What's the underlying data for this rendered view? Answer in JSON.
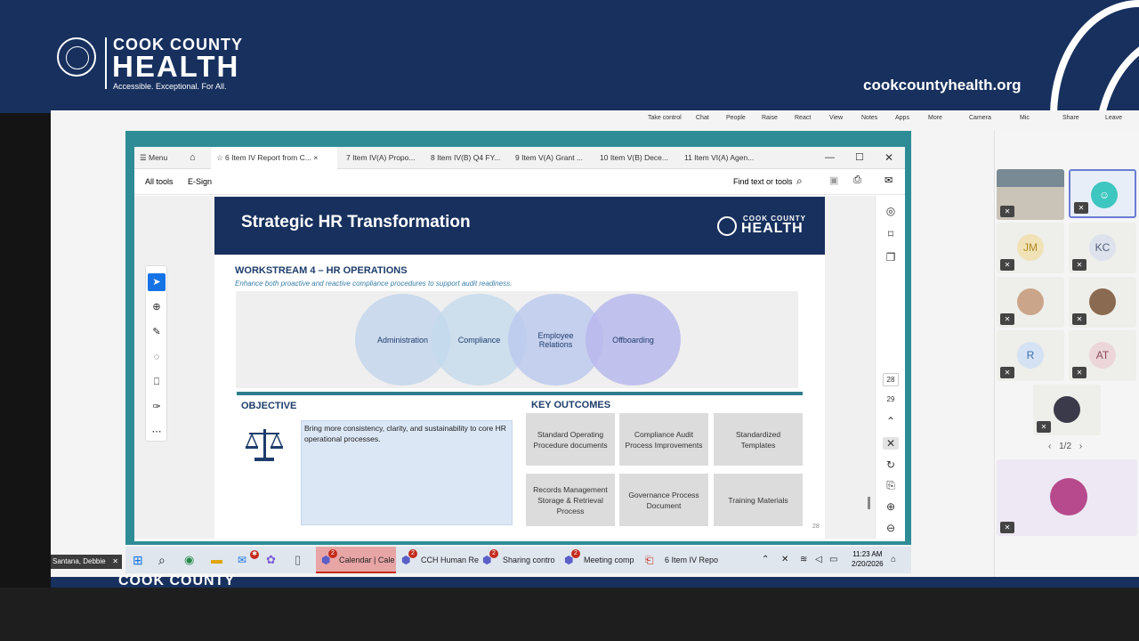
{
  "banner": {
    "logo_line1": "COOK COUNTY",
    "logo_line2": "HEALTH",
    "tagline": "Accessible. Exceptional. For All.",
    "url": "cookcountyhealth.org"
  },
  "teams": {
    "controls": [
      "Take control",
      "Chat",
      "People",
      "Raise",
      "React",
      "View",
      "Notes",
      "Apps",
      "More",
      "Camera",
      "Mic",
      "Share",
      "Leave"
    ],
    "participants": [
      {
        "initials": "JM",
        "color": "#c9a227"
      },
      {
        "initials": "KC",
        "color": "#555f7a"
      },
      {
        "initials": "R",
        "color": "#3a6fb0"
      },
      {
        "initials": "AT",
        "color": "#8a4a5a"
      }
    ],
    "pager": "1/2",
    "presenter_name": "Santana, Debbie"
  },
  "acrobat": {
    "menu_label": "Menu",
    "tabs": [
      "6 Item IV Report from C...",
      "7 Item IV(A) Propo...",
      "8 Item IV(B) Q4 FY...",
      "9 Item V(A) Grant ...",
      "10 Item V(B) Dece...",
      "11 Item VI(A) Agen..."
    ],
    "toolbar": {
      "all_tools": "All tools",
      "esign": "E-Sign",
      "find": "Find text or tools"
    },
    "page_numbers": [
      "28",
      "29"
    ]
  },
  "slide": {
    "title": "Strategic HR Transformation",
    "logo_line1": "COOK COUNTY",
    "logo_line2": "HEALTH",
    "workstream": "WORKSTREAM 4 – HR OPERATIONS",
    "subtitle": "Enhance both proactive and reactive compliance procedures to support audit readiness.",
    "circles": [
      "Administration",
      "Compliance",
      "Employee Relations",
      "Offboarding"
    ],
    "objective_label": "OBJECTIVE",
    "objective_text": "Bring more consistency, clarity, and sustainability to core HR operational processes.",
    "key_outcomes_label": "KEY OUTCOMES",
    "outcomes": [
      "Standard Operating Procedure documents",
      "Compliance Audit Process Improvements",
      "Standardized Templates",
      "Records Management Storage & Retrieval Process",
      "Governance Process Document",
      "Training Materials"
    ],
    "page_num": "28"
  },
  "taskbar": {
    "apps": [
      "Calendar | Cale",
      "CCH Human Re",
      "Sharing contro",
      "Meeting comp",
      "6 Item IV Repo"
    ],
    "badge": "2",
    "time": "11:23 AM",
    "date": "2/20/2026"
  },
  "bottom": {
    "logo": "COOK COUNTY"
  }
}
